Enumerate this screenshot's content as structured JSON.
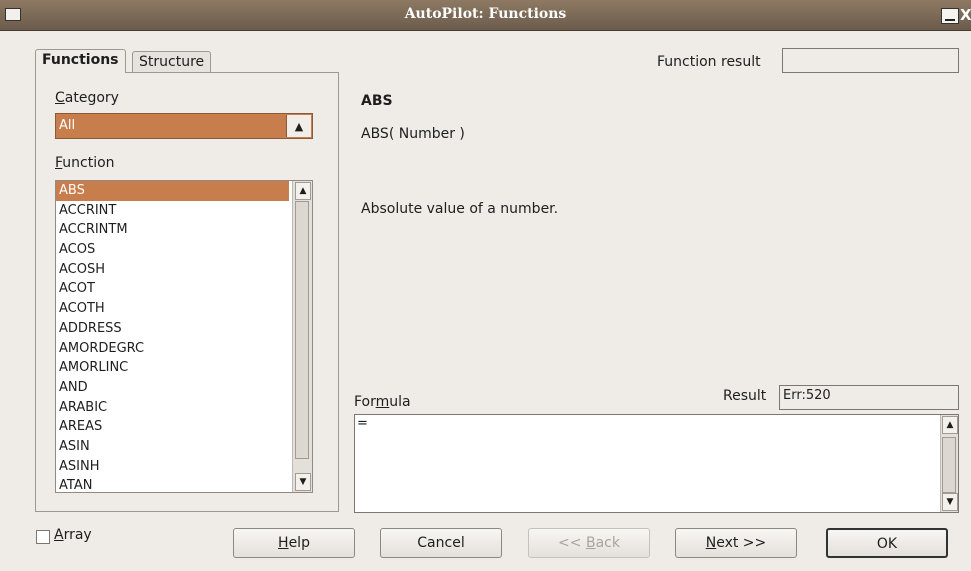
{
  "window": {
    "title": "AutoPilot: Functions",
    "close_glyph": "X"
  },
  "tabs": [
    "Functions",
    "Structure"
  ],
  "function_result": {
    "label": "Function result",
    "value": ""
  },
  "category": {
    "label_underline": "C",
    "label_rest": "ategory",
    "value": "All"
  },
  "function": {
    "label_underline": "F",
    "label_rest": "unction",
    "items": [
      "ABS",
      "ACCRINT",
      "ACCRINTM",
      "ACOS",
      "ACOSH",
      "ACOT",
      "ACOTH",
      "ADDRESS",
      "AMORDEGRC",
      "AMORLINC",
      "AND",
      "ARABIC",
      "AREAS",
      "ASIN",
      "ASINH",
      "ATAN"
    ],
    "selected": "ABS"
  },
  "description": {
    "name": "ABS",
    "syntax": "ABS( Number )",
    "text": "Absolute value of a number."
  },
  "formula": {
    "label_a": "For",
    "label_underline": "m",
    "label_b": "ula",
    "value": "="
  },
  "result": {
    "label": "Result",
    "value": "Err:520"
  },
  "array": {
    "label_underline": "A",
    "label_rest": "rray",
    "checked": false
  },
  "buttons": {
    "help": {
      "underline": "H",
      "rest": "elp"
    },
    "cancel": "Cancel",
    "back": {
      "pre": "<< ",
      "underline": "B",
      "rest": "ack"
    },
    "next": {
      "underline": "N",
      "rest": "ext >>"
    },
    "ok": "OK"
  },
  "colors": {
    "selection": "#c87d4d",
    "titlebar": "#7c6a58"
  }
}
